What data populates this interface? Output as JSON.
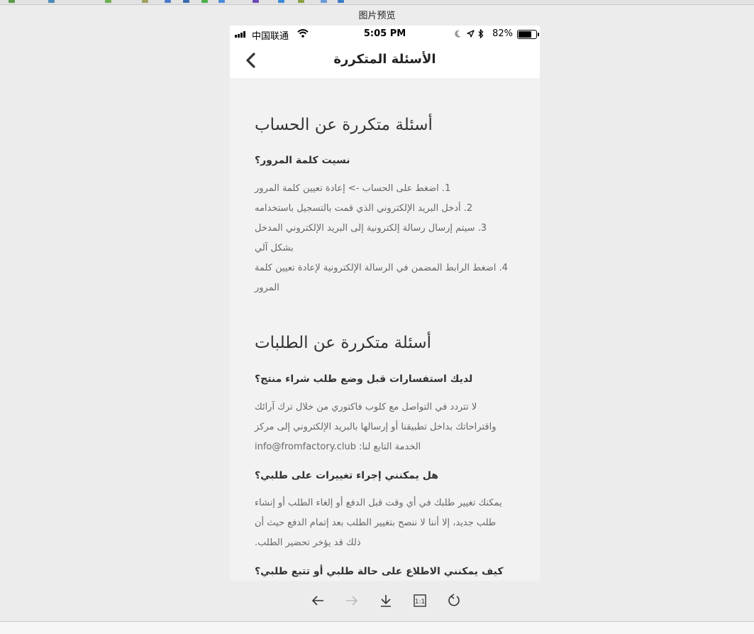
{
  "window": {
    "title": "图片预览"
  },
  "status_bar": {
    "carrier": "中国联通",
    "time": "5:05 PM",
    "battery": "82%",
    "battery_level": 0.82,
    "icons": [
      "signal-icon",
      "wifi-icon",
      "moon-icon",
      "location-arrow-icon",
      "bluetooth-icon",
      "battery-icon"
    ]
  },
  "nav": {
    "title": "الأسئلة المتكررة",
    "back_icon": "chevron-left-icon"
  },
  "sections": [
    {
      "title": "أسئلة متكررة عن الحساب",
      "questions": [
        {
          "question": "نسيت كلمة المرور؟",
          "lines": [
            "1. اضغط على الحساب -> إعادة تعيين كلمة المرور",
            "2. أدخل البريد الإلكتروني الذي قمت بالتسجيل باستخدامه",
            "3. سيتم إرسال رسالة إلكترونية إلى البريد الإلكتروني المدخل",
            "بشكل آلي",
            "4. اضغط الرابط المضمن في الرسالة الإلكترونية لإعادة تعيين كلمة",
            "المرور"
          ]
        }
      ]
    },
    {
      "title": "أسئلة متكررة عن الطلبات",
      "questions": [
        {
          "question": "لديك استفسارات قبل وضع طلب شراء منتج؟",
          "lines": [
            "لا تتردد في التواصل مع كلوب فاكتوري من خلال ترك آرائك",
            "واقتراحاتك بداخل تطبيقنا أو إرسالها بالبريد الإلكتروني إلى مركز",
            "الخدمة التابع لنا: info@fromfactory.club"
          ]
        },
        {
          "question": "هل يمكنني إجراء تغييرات على طلبي؟",
          "lines": [
            "يمكنك تغيير طلبك في أي وقت قبل الدفع أو إلغاء الطلب أو إنشاء",
            "طلب جديد، إلا أننا لا ننصح بتغيير الطلب بعد إتمام الدفع حيث أن",
            "ذلك قد يؤخر تحضير الطلب."
          ]
        },
        {
          "question": "كيف يمكنني الاطلاع على حالة طلبي أو تتبع طلبي؟",
          "lines": []
        }
      ]
    }
  ],
  "toolbar": {
    "buttons": [
      "arrow-left-icon",
      "arrow-right-icon",
      "download-icon",
      "actual-size-icon",
      "refresh-icon"
    ],
    "actual_size_label": "1:1"
  }
}
